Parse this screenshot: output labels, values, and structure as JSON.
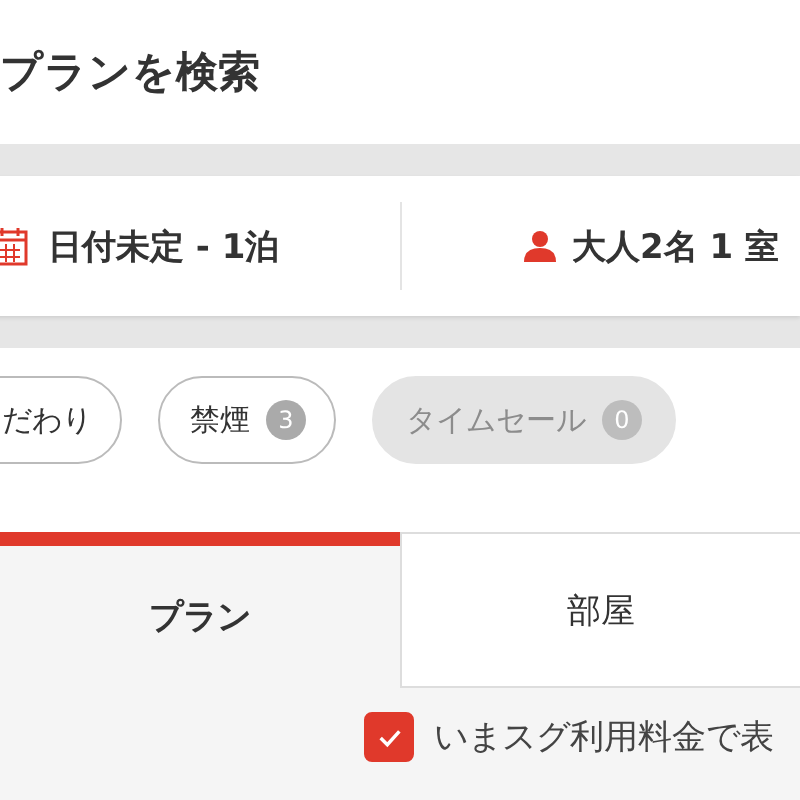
{
  "header": {
    "title": "プランを検索"
  },
  "search": {
    "date": "日付未定 - 1泊",
    "guests": "大人2名 1 室"
  },
  "filters": [
    {
      "label": "だわり",
      "disabled": false
    },
    {
      "label": "禁煙",
      "count": "3",
      "disabled": false
    },
    {
      "label": "タイムセール",
      "count": "0",
      "disabled": true
    }
  ],
  "tabs": [
    {
      "label": "プラン",
      "selected": true
    },
    {
      "label": "部屋",
      "selected": false
    }
  ],
  "option": {
    "label": "いまスグ利用料金で表",
    "checked": true
  }
}
